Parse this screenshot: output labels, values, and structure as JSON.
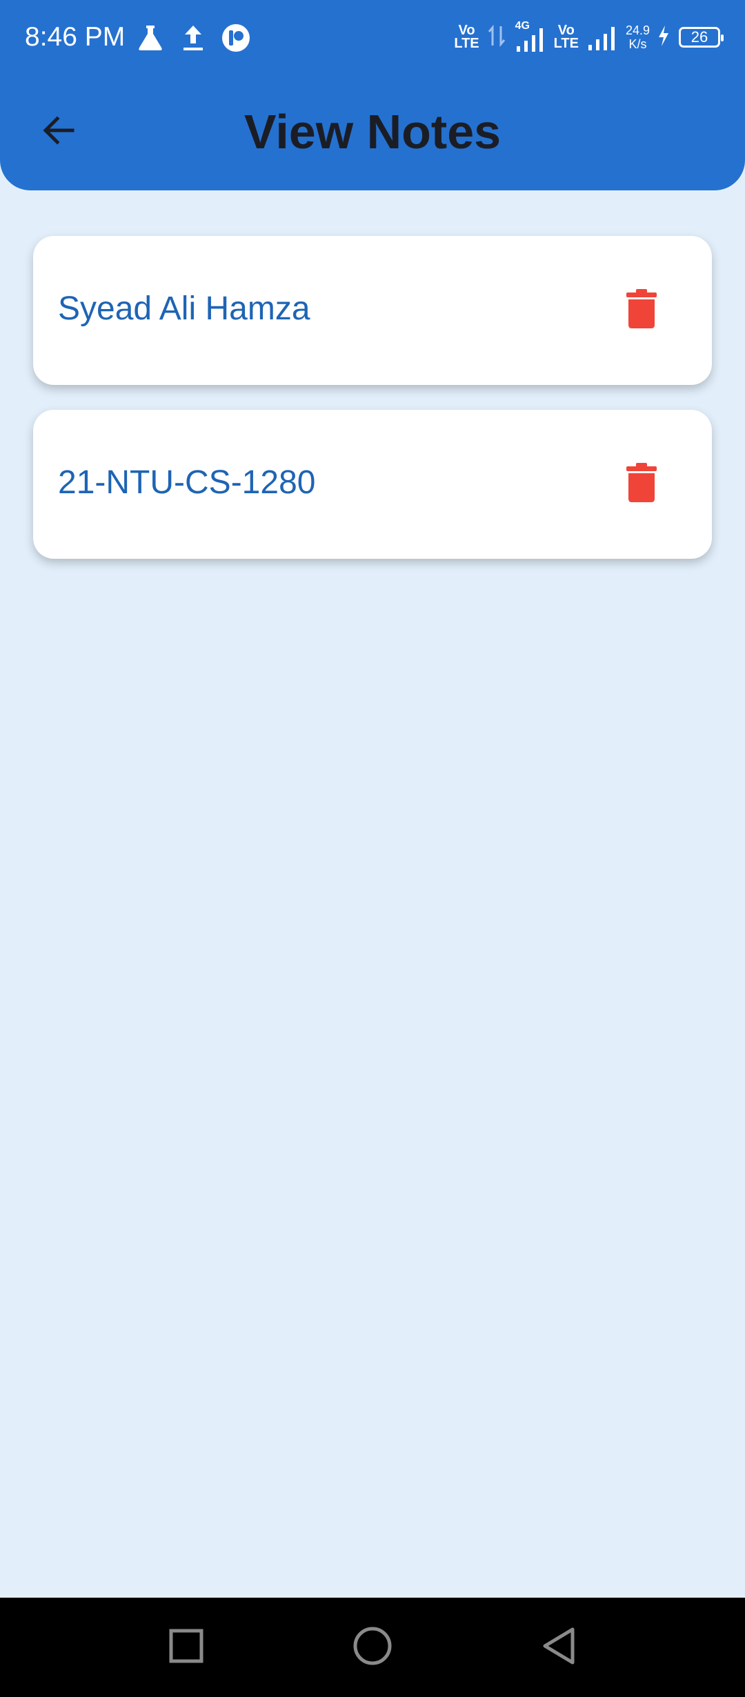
{
  "status_bar": {
    "time": "8:46 PM",
    "left_icons": [
      "flask-icon",
      "upload-icon",
      "app-notification-icon"
    ],
    "volte_1": "Vo\nLTE",
    "network_type": "4G",
    "volte_2": "Vo\nLTE",
    "net_speed_value": "24.9",
    "net_speed_unit": "K/s",
    "battery": "26"
  },
  "app_bar": {
    "title": "View Notes",
    "back_icon": "arrow-left-icon"
  },
  "notes": [
    {
      "title": "Syead Ali Hamza",
      "action_icon": "trash-icon"
    },
    {
      "title": "21-NTU-CS-1280",
      "action_icon": "trash-icon"
    }
  ],
  "nav_bar": {
    "buttons": [
      "recents-square-icon",
      "home-circle-icon",
      "back-triangle-icon"
    ]
  },
  "colors": {
    "header_blue": "#2571d0",
    "background": "#e2effb",
    "note_text": "#1e64b4",
    "delete_red": "#f04438"
  }
}
